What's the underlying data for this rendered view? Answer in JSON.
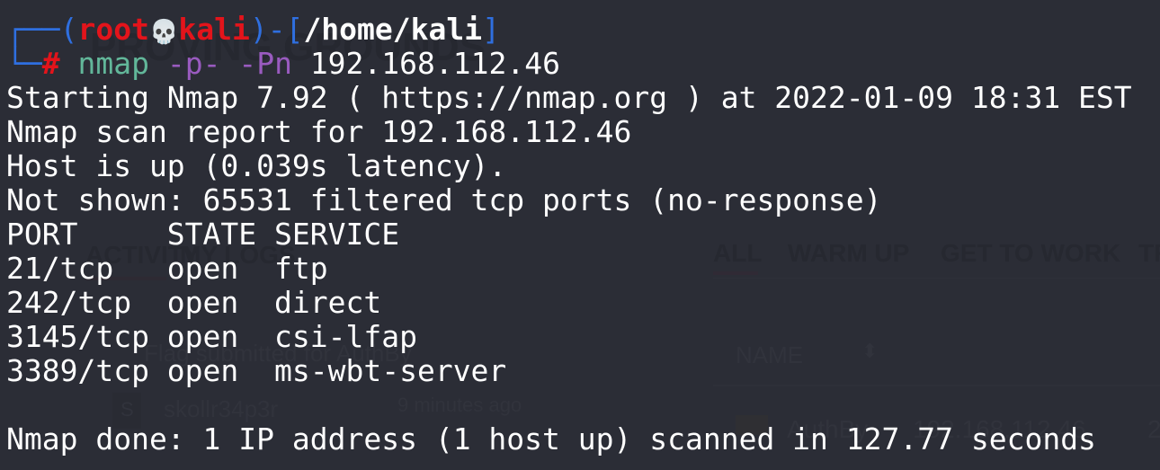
{
  "background_page": {
    "brand": "PROVING GROUNDS",
    "left_tabs": [
      "ACTIVITY",
      "MY LOGS"
    ],
    "activity_item": {
      "text": "Flag submitted for AuthBy",
      "user_initial": "S",
      "user": "skollr34p3r",
      "time": "9 minutes ago"
    },
    "right_tabs": [
      "ALL",
      "WARM UP",
      "GET TO WORK",
      "TR"
    ],
    "table_header": "NAME",
    "table_row": {
      "name": "AuthBy",
      "ip": "192.168.112.46",
      "extra": "2"
    }
  },
  "terminal": {
    "prompt": {
      "user": "root",
      "separator_icon": "skull-icon",
      "host": "kali",
      "path": "/home/kali",
      "symbol": "#"
    },
    "command": {
      "program": "nmap",
      "flags": "-p- -Pn",
      "target": "192.168.112.46"
    },
    "output": [
      "Starting Nmap 7.92 ( https://nmap.org ) at 2022-01-09 18:31 EST",
      "Nmap scan report for 192.168.112.46",
      "Host is up (0.039s latency).",
      "Not shown: 65531 filtered tcp ports (no-response)",
      "PORT     STATE SERVICE",
      "21/tcp   open  ftp",
      "242/tcp  open  direct",
      "3145/tcp open  csi-lfap",
      "3389/tcp open  ms-wbt-server",
      "",
      "Nmap done: 1 IP address (1 host up) scanned in 127.77 seconds"
    ]
  },
  "colors": {
    "background": "#2b2d36",
    "prompt_frame": "#2f6fe0",
    "user_host": "#e3141b",
    "program": "#62b79a",
    "flags": "#9a5bc0"
  }
}
